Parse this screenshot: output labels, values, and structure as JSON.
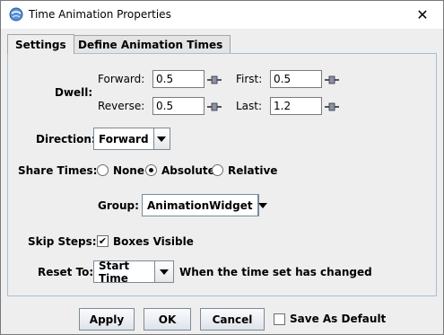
{
  "window": {
    "title": "Time Animation Properties"
  },
  "tabs": [
    {
      "label": "Settings"
    },
    {
      "label": "Define Animation Times"
    }
  ],
  "dwell": {
    "label": "Dwell:",
    "forward_label": "Forward:",
    "forward_value": "0.5",
    "reverse_label": "Reverse:",
    "reverse_value": "0.5",
    "first_label": "First:",
    "first_value": "0.5",
    "last_label": "Last:",
    "last_value": "1.2"
  },
  "direction": {
    "label": "Direction:",
    "value": "Forward"
  },
  "share_times": {
    "label": "Share Times:",
    "options": [
      {
        "label": "None",
        "selected": false
      },
      {
        "label": "Absolute",
        "selected": true
      },
      {
        "label": "Relative",
        "selected": false
      }
    ]
  },
  "group": {
    "label": "Group:",
    "value": "AnimationWidget"
  },
  "skip_steps": {
    "label": "Skip Steps:",
    "checkbox_label": "Boxes Visible",
    "checked": true
  },
  "reset_to": {
    "label": "Reset To:",
    "value": "Start Time",
    "note": "When the time set has changed"
  },
  "buttons": {
    "apply": "Apply",
    "ok": "OK",
    "cancel": "Cancel",
    "save_default": "Save As Default",
    "save_default_checked": false
  }
}
